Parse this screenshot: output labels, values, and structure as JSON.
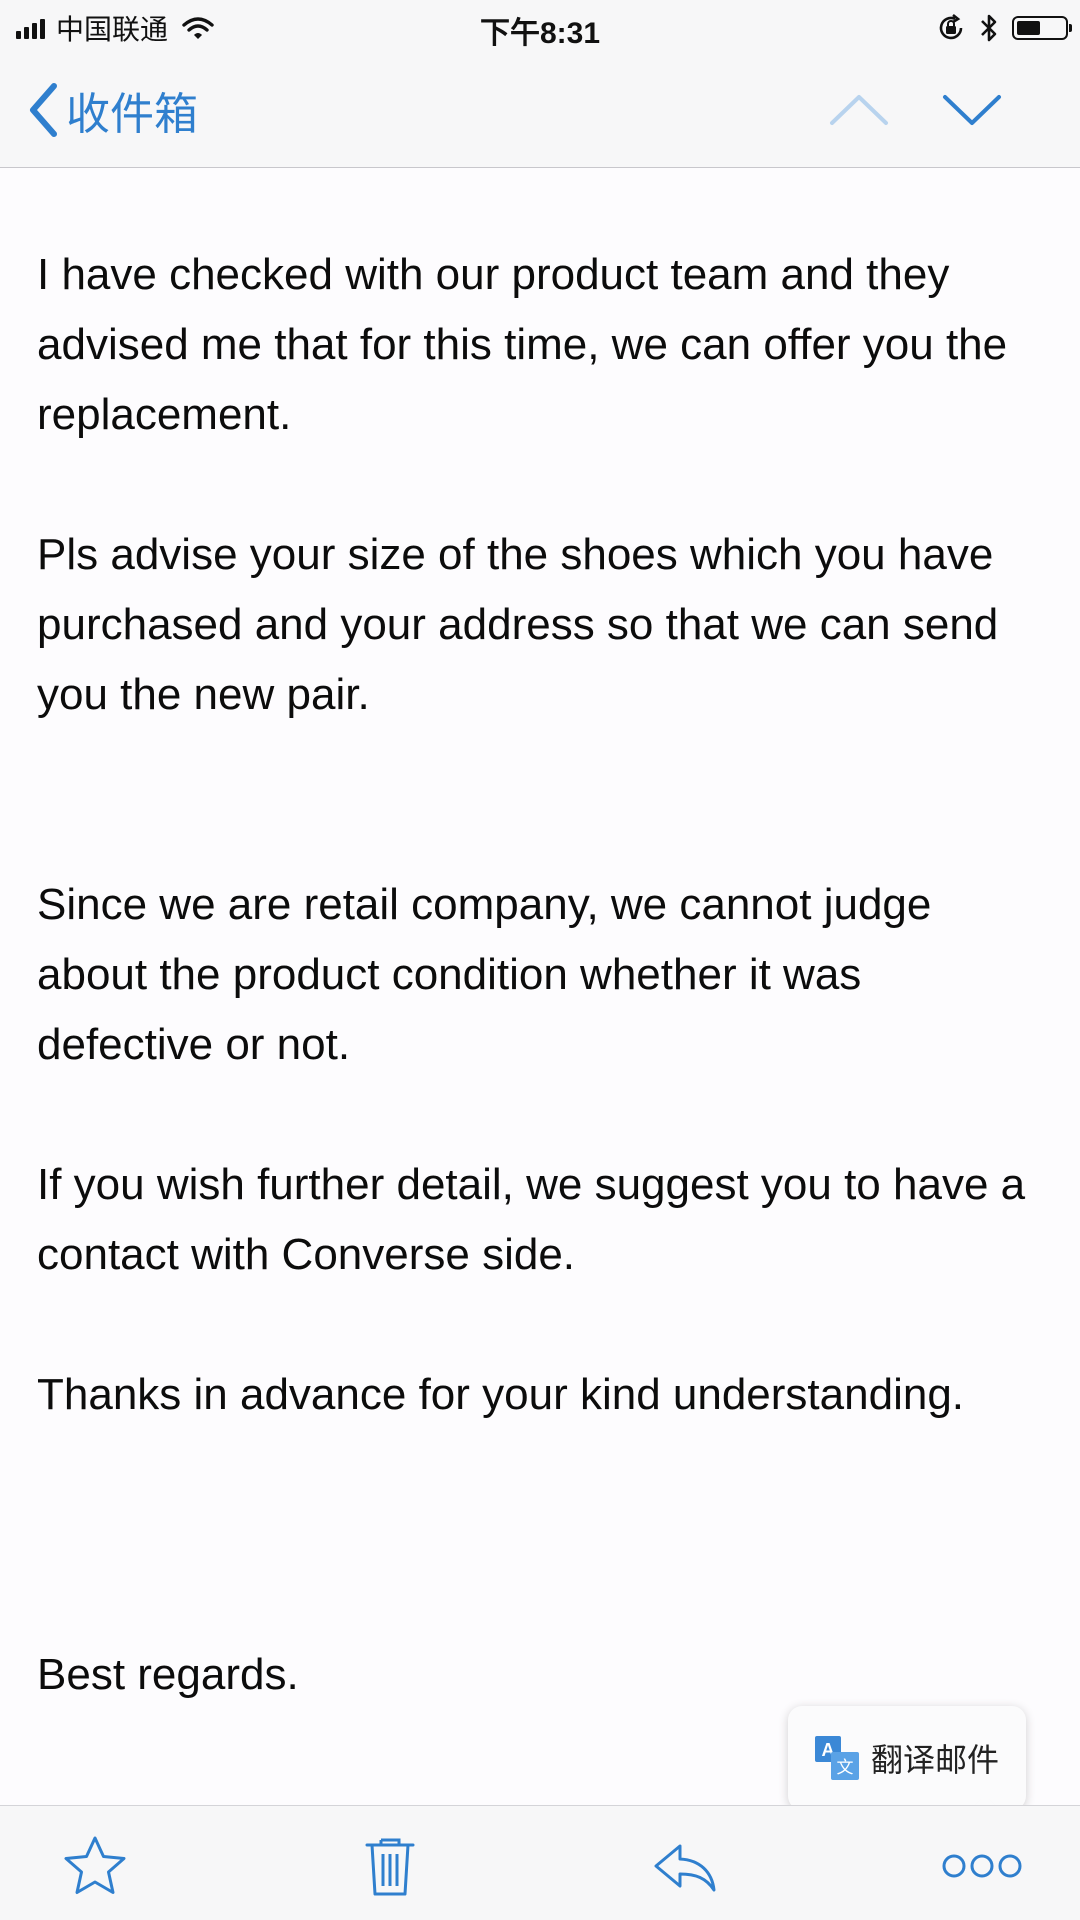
{
  "status_bar": {
    "carrier": "中国联通",
    "time": "下午8:31",
    "battery_level": 0.5
  },
  "nav": {
    "back_label": "收件箱",
    "back_icon": "chevron-left-icon",
    "prev_icon": "chevron-up-icon",
    "next_icon": "chevron-down-icon"
  },
  "message": {
    "paragraphs": [
      "I have checked with our product team and they advised me that for this time, we can offer you the replacement.",
      "Pls advise your size of the shoes which you have purchased and your address so that we can send you the new pair.",
      "Since we are retail company, we cannot judge about the product condition whether it was defective or not.",
      "If you wish further detail, we suggest you to have a contact with Converse side.",
      "Thanks in advance for your kind understanding.",
      "Best regards."
    ]
  },
  "translate_popup": {
    "label": "翻译邮件",
    "icon": "translate-icon"
  },
  "toolbar": {
    "items": [
      "flag-icon",
      "trash-icon",
      "reply-icon",
      "more-icon"
    ]
  },
  "colors": {
    "accent": "#2f7fce",
    "disabled_accent": "#b8d3ee",
    "background": "#fdfcfe",
    "bar_background": "#f7f7f8"
  }
}
